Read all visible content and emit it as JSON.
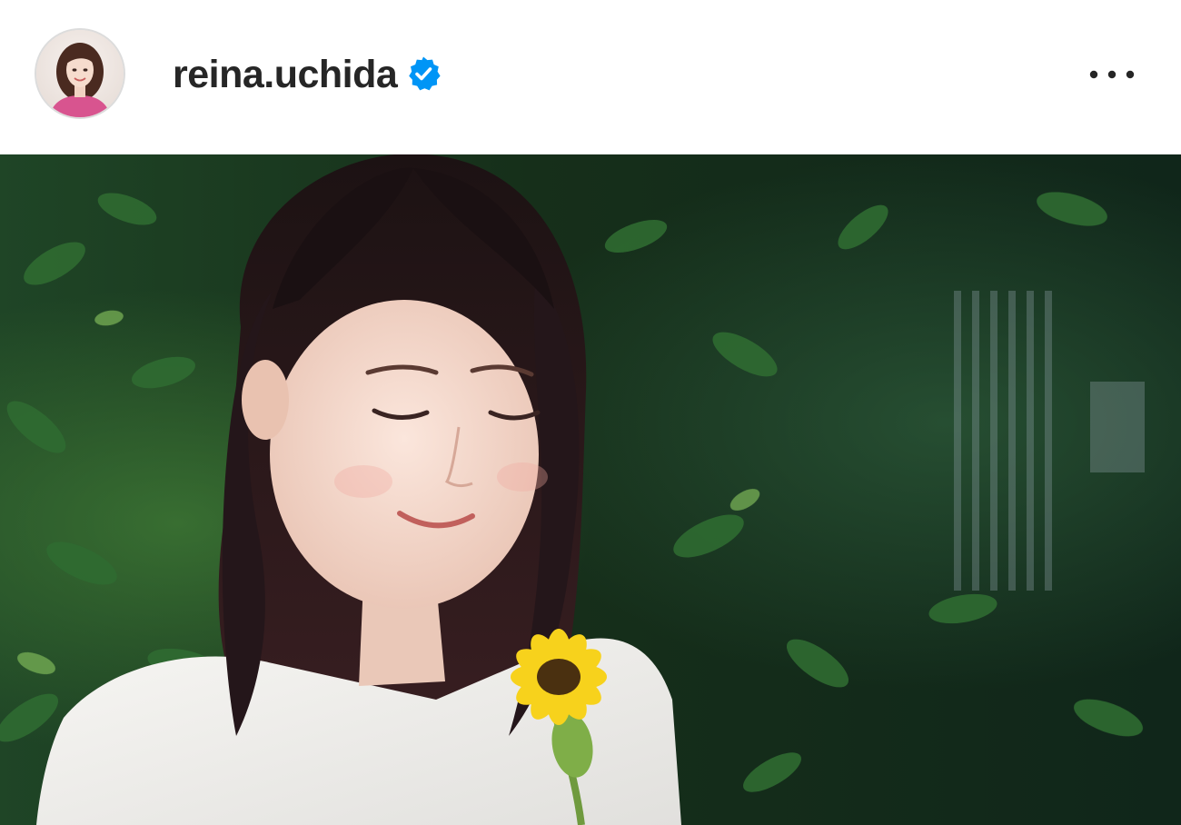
{
  "post": {
    "username": "reina.uchida",
    "verified": true
  },
  "icons": {
    "avatar": "profile-photo",
    "verified_badge": "verified-badge-icon",
    "more": "more-options-icon"
  },
  "colors": {
    "username_text": "#262626",
    "verified_blue": "#0095f6",
    "background": "#ffffff"
  }
}
